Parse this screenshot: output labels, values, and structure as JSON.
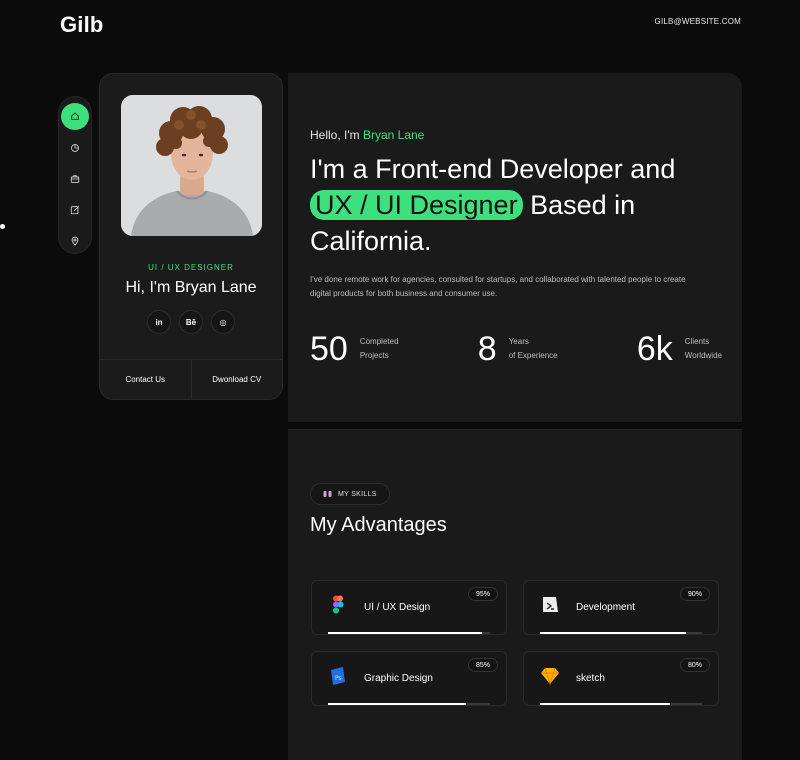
{
  "header": {
    "logo": "Gilb",
    "email": "GILB@WEBSITE.COM"
  },
  "nav": {
    "items": [
      {
        "icon": "home-icon",
        "active": true
      },
      {
        "icon": "chart-pie-icon",
        "active": false
      },
      {
        "icon": "briefcase-icon",
        "active": false
      },
      {
        "icon": "edit-icon",
        "active": false
      },
      {
        "icon": "location-pin-icon",
        "active": false
      }
    ]
  },
  "profile": {
    "role": "UI / UX DESIGNER",
    "name": "Hi, I'm Bryan Lane",
    "socials": [
      {
        "icon": "linkedin-icon",
        "label": "in"
      },
      {
        "icon": "behance-icon",
        "label": "Bē"
      },
      {
        "icon": "dribbble-icon",
        "label": "◎"
      }
    ],
    "contact_label": "Contact Us",
    "download_label": "Dwonload CV"
  },
  "hero": {
    "hello_prefix": "Hello, I'm ",
    "hello_name": "Bryan Lane",
    "headline_1": "I'm a Front-end Developer and",
    "headline_highlight": "UX / UI Designer",
    "headline_2": " Based in",
    "headline_3": "California.",
    "intro": "I've done remote work for agencies, consulted for startups, and collaborated with talented people to create digital products for both business and consumer use.",
    "stats": [
      {
        "value": "50",
        "label_1": "Completed",
        "label_2": "Projects"
      },
      {
        "value": "8",
        "label_1": "Years",
        "label_2": "of Experience"
      },
      {
        "value": "6k",
        "label_1": "Clients",
        "label_2": "Worldwide"
      }
    ]
  },
  "skills": {
    "pill": "MY SKILLS",
    "title": "My Advantages",
    "items": [
      {
        "name": "UI / UX Design",
        "percent_label": "95%",
        "level": 0.95,
        "icon": "figma-icon"
      },
      {
        "name": "Development",
        "percent_label": "90%",
        "level": 0.9,
        "icon": "code-icon"
      },
      {
        "name": "Graphic Design",
        "percent_label": "85%",
        "level": 0.85,
        "icon": "photoshop-icon"
      },
      {
        "name": "sketch",
        "percent_label": "80%",
        "level": 0.8,
        "icon": "sketch-icon"
      }
    ]
  },
  "colors": {
    "accent": "#3ee07d",
    "background": "#0b0b0b",
    "panel": "#1a1a1a"
  }
}
